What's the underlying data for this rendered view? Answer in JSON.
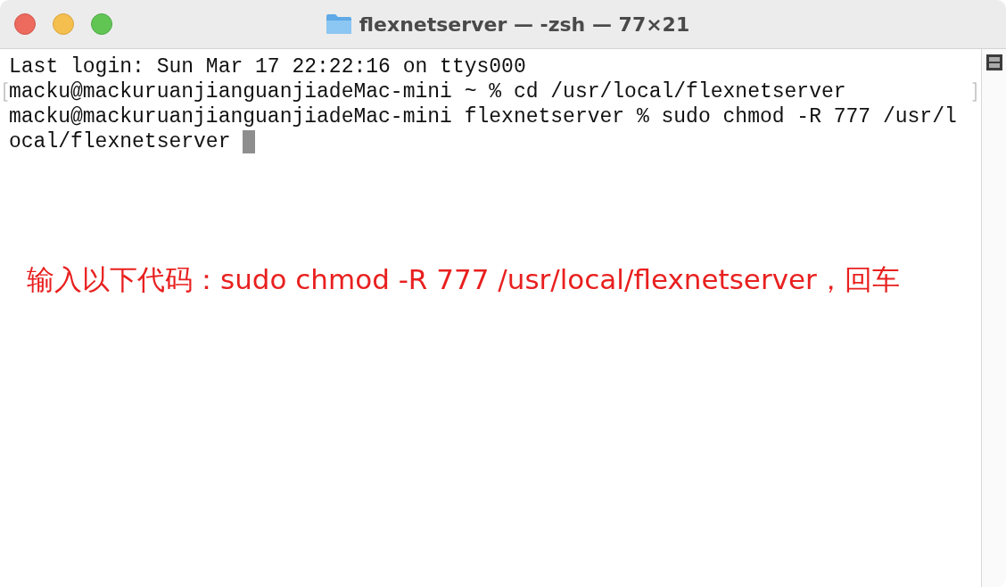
{
  "window": {
    "title": "flexnetserver — -zsh — 77×21"
  },
  "terminal": {
    "lines": [
      {
        "text": "Last login: Sun Mar 17 22:22:16 on ttys000",
        "marked": false,
        "cursor": false
      },
      {
        "text": "macku@mackuruanjianguanjiadeMac-mini ~ % cd /usr/local/flexnetserver",
        "marked": true,
        "cursor": false
      },
      {
        "text": "macku@mackuruanjianguanjiadeMac-mini flexnetserver % sudo chmod -R 777 /usr/l",
        "marked": false,
        "cursor": false
      },
      {
        "text": "ocal/flexnetserver",
        "marked": false,
        "cursor": true
      }
    ]
  },
  "annotation": {
    "text": "输入以下代码：sudo chmod -R 777 /usr/local/flexnetserver，回车"
  }
}
